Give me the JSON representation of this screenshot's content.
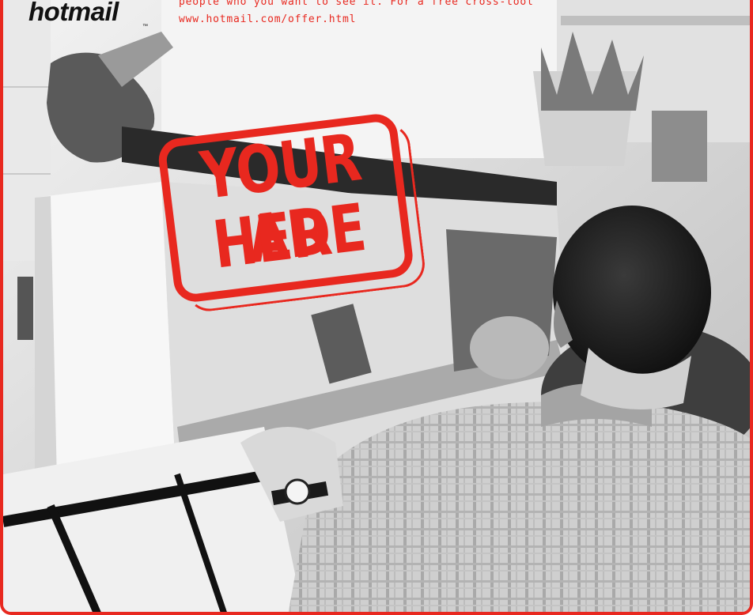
{
  "ad": {
    "brand": "hotmail",
    "brand_mark": "™",
    "offer_lines": [
      "people who you want to see it. For a free cross-tool",
      "www.hotmail.com/offer.html"
    ],
    "stamp_lines": [
      "YOUR AD",
      "HERE"
    ],
    "accent_color": "#e8281f",
    "photo_description_hidden": ""
  },
  "icons": {
    "photo": "kitchen-photo-icon"
  }
}
